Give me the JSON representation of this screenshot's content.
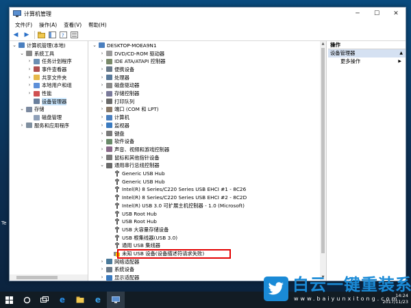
{
  "window": {
    "title": "计算机管理",
    "controls": {
      "minimize": "─",
      "maximize": "☐",
      "close": "✕"
    }
  },
  "menu": [
    "文件(F)",
    "操作(A)",
    "查看(V)",
    "帮助(H)"
  ],
  "left_tree": [
    {
      "label": "计算机管理(本地)",
      "depth": 0,
      "expander": "⌄",
      "icon": "computer-icon",
      "color": "#4a7fbf"
    },
    {
      "label": "系统工具",
      "depth": 1,
      "expander": "⌄",
      "icon": "tools-icon",
      "color": "#8a8a8a"
    },
    {
      "label": "任务计划程序",
      "depth": 2,
      "expander": "›",
      "icon": "clock-icon",
      "color": "#6b8fb3"
    },
    {
      "label": "事件查看器",
      "depth": 2,
      "expander": "›",
      "icon": "event-icon",
      "color": "#b05050"
    },
    {
      "label": "共享文件夹",
      "depth": 2,
      "expander": "›",
      "icon": "folder-icon",
      "color": "#e6b84a"
    },
    {
      "label": "本地用户和组",
      "depth": 2,
      "expander": "›",
      "icon": "users-icon",
      "color": "#5d8fd8"
    },
    {
      "label": "性能",
      "depth": 2,
      "expander": "›",
      "icon": "performance-icon",
      "color": "#d05050"
    },
    {
      "label": "设备管理器",
      "depth": 2,
      "expander": "",
      "icon": "device-manager-icon",
      "color": "#6a7f9c",
      "selected": true
    },
    {
      "label": "存储",
      "depth": 1,
      "expander": "⌄",
      "icon": "storage-icon",
      "color": "#7c8aa0"
    },
    {
      "label": "磁盘管理",
      "depth": 2,
      "expander": "",
      "icon": "disk-icon",
      "color": "#8fa0b8"
    },
    {
      "label": "服务和应用程序",
      "depth": 1,
      "expander": "›",
      "icon": "services-icon",
      "color": "#7f8f9f"
    }
  ],
  "device_tree": [
    {
      "label": "DESKTOP-MOEA9N1",
      "depth": 0,
      "expander": "⌄",
      "icon": "computer-icon",
      "color": "#4a7fbf"
    },
    {
      "label": "DVD/CD-ROM 驱动器",
      "depth": 1,
      "expander": "›",
      "icon": "dvd-icon",
      "color": "#9a9a9a"
    },
    {
      "label": "IDE ATA/ATAPI 控制器",
      "depth": 1,
      "expander": "›",
      "icon": "ide-icon",
      "color": "#7a8a6a"
    },
    {
      "label": "便携设备",
      "depth": 1,
      "expander": "›",
      "icon": "portable-icon",
      "color": "#6a7a8a"
    },
    {
      "label": "处理器",
      "depth": 1,
      "expander": "›",
      "icon": "cpu-icon",
      "color": "#5a7a9a"
    },
    {
      "label": "磁盘驱动器",
      "depth": 1,
      "expander": "›",
      "icon": "disk-icon",
      "color": "#8a8a8a"
    },
    {
      "label": "存储控制器",
      "depth": 1,
      "expander": "›",
      "icon": "storage-icon",
      "color": "#7a7a9a"
    },
    {
      "label": "打印队列",
      "depth": 1,
      "expander": "›",
      "icon": "printer-icon",
      "color": "#6a6a6a"
    },
    {
      "label": "端口 (COM 和 LPT)",
      "depth": 1,
      "expander": "›",
      "icon": "port-icon",
      "color": "#8a7a6a"
    },
    {
      "label": "计算机",
      "depth": 1,
      "expander": "›",
      "icon": "computer-icon",
      "color": "#4a7fbf"
    },
    {
      "label": "监视器",
      "depth": 1,
      "expander": "›",
      "icon": "monitor-icon",
      "color": "#3a7abf"
    },
    {
      "label": "键盘",
      "depth": 1,
      "expander": "›",
      "icon": "keyboard-icon",
      "color": "#7a7a7a"
    },
    {
      "label": "软件设备",
      "depth": 1,
      "expander": "›",
      "icon": "software-icon",
      "color": "#6a8a6a"
    },
    {
      "label": "声音、视频和游戏控制器",
      "depth": 1,
      "expander": "›",
      "icon": "sound-icon",
      "color": "#8a6a8a"
    },
    {
      "label": "鼠标和其他指针设备",
      "depth": 1,
      "expander": "›",
      "icon": "mouse-icon",
      "color": "#7a7a7a"
    },
    {
      "label": "通用串行总线控制器",
      "depth": 1,
      "expander": "⌄",
      "icon": "usb-controller-icon",
      "color": "#6a6a6a"
    },
    {
      "label": "Generic USB Hub",
      "depth": 2,
      "expander": "",
      "icon": "usb-icon",
      "color": "#555555"
    },
    {
      "label": "Generic USB Hub",
      "depth": 2,
      "expander": "",
      "icon": "usb-icon",
      "color": "#555555"
    },
    {
      "label": "Intel(R) 8 Series/C220 Series USB EHCI #1 - 8C26",
      "depth": 2,
      "expander": "",
      "icon": "usb-icon",
      "color": "#555555"
    },
    {
      "label": "Intel(R) 8 Series/C220 Series USB EHCI #2 - 8C2D",
      "depth": 2,
      "expander": "",
      "icon": "usb-icon",
      "color": "#555555"
    },
    {
      "label": "Intel(R) USB 3.0 可扩展主机控制器 - 1.0 (Microsoft)",
      "depth": 2,
      "expander": "",
      "icon": "usb-icon",
      "color": "#555555"
    },
    {
      "label": "USB Root Hub",
      "depth": 2,
      "expander": "",
      "icon": "usb-icon",
      "color": "#555555"
    },
    {
      "label": "USB Root Hub",
      "depth": 2,
      "expander": "",
      "icon": "usb-icon",
      "color": "#555555"
    },
    {
      "label": "USB 大容量存储设备",
      "depth": 2,
      "expander": "",
      "icon": "usb-icon",
      "color": "#555555"
    },
    {
      "label": "USB 根集线器(USB 3.0)",
      "depth": 2,
      "expander": "",
      "icon": "usb-icon",
      "color": "#555555"
    },
    {
      "label": "通用 USB 集线器",
      "depth": 2,
      "expander": "",
      "icon": "usb-icon",
      "color": "#555555"
    },
    {
      "label": "未知 USB 设备(设备描述符请求失败)",
      "depth": 2,
      "expander": "",
      "icon": "unknown-device-warning-icon",
      "color": "#555555",
      "warning": true
    },
    {
      "label": "网络适配器",
      "depth": 1,
      "expander": "›",
      "icon": "network-icon",
      "color": "#4a7a9a"
    },
    {
      "label": "系统设备",
      "depth": 1,
      "expander": "›",
      "icon": "system-icon",
      "color": "#6a7a8a"
    },
    {
      "label": "显示适配器",
      "depth": 1,
      "expander": "›",
      "icon": "display-icon",
      "color": "#3a7abf"
    }
  ],
  "actions": {
    "header": "操作",
    "section": "设备管理器",
    "more": "更多操作"
  },
  "taskbar": {
    "time": "14:24",
    "date": "2017/11/23"
  },
  "desktop_label": "Te",
  "watermark": {
    "title": "白云一键重装系统",
    "url": "www.baiyunxitong.com"
  },
  "colors": {
    "highlight": "#e30000",
    "selection": "#cce8ff",
    "brand": "#1a8ad6"
  }
}
